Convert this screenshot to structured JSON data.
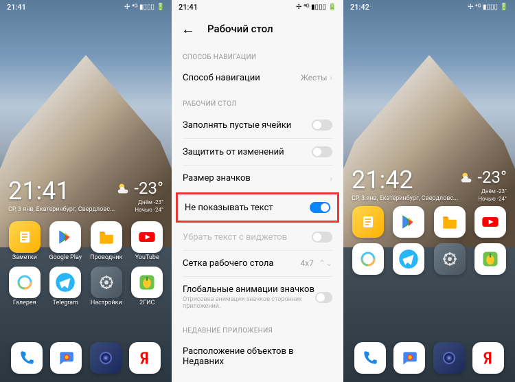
{
  "status": {
    "time1": "21:41",
    "time2": "21:41",
    "time3": "21:42",
    "icons": "✢ ⁴ᴳ ▮▯▯▯ 🔋"
  },
  "p1": {
    "clock": "21:41",
    "date": "СР, 3 янв, Екатеринбург, Свердловс...",
    "temp": "-23°",
    "wsub1": "Днём -23°",
    "wsub2": "Ночью -24°",
    "widgetTop": 260,
    "gridTop": 322,
    "apps": [
      {
        "key": "notes",
        "label": "Заметки"
      },
      {
        "key": "play",
        "label": "Google Play"
      },
      {
        "key": "files",
        "label": "Проводник"
      },
      {
        "key": "yt",
        "label": "YouTube"
      },
      {
        "key": "gallery",
        "label": "Галерея"
      },
      {
        "key": "tg",
        "label": "Telegram"
      },
      {
        "key": "settings",
        "label": "Настройки"
      },
      {
        "key": "2gis",
        "label": "2ГИС"
      }
    ]
  },
  "p3": {
    "clock": "21:42",
    "date": "СР, 3 янв, Екатеринбург, Свердловс...",
    "temp": "-23°",
    "wsub1": "Днём -23°",
    "wsub2": "Ночью -24°",
    "widgetTop": 244,
    "gridTop": 300,
    "apps": [
      {
        "key": "notes"
      },
      {
        "key": "play"
      },
      {
        "key": "files"
      },
      {
        "key": "yt"
      },
      {
        "key": "gallery"
      },
      {
        "key": "tg"
      },
      {
        "key": "settings"
      },
      {
        "key": "2gis"
      }
    ]
  },
  "dock": [
    {
      "key": "phone"
    },
    {
      "key": "msg"
    },
    {
      "key": "cam"
    },
    {
      "key": "ya"
    }
  ],
  "settings": {
    "title": "Рабочий стол",
    "sec1": "СПОСОБ НАВИГАЦИИ",
    "navMethod": "Способ навигации",
    "navVal": "Жесты",
    "sec2": "РАБОЧИЙ СТОЛ",
    "fillEmpty": "Заполнять пустые ячейки",
    "protect": "Защитить от изменений",
    "iconSize": "Размер значков",
    "hideText": "Не показывать текст",
    "removeWidget": "Убрать текст с виджетов",
    "grid": "Сетка рабочего стола",
    "gridVal": "4x7",
    "globalAnim": "Глобальные анимации значков",
    "globalAnimSub": "Отрисовка анимации значков сторонних приложений.",
    "sec3": "НЕДАВНИЕ ПРИЛОЖЕНИЯ",
    "recents": "Расположение объектов в Недавних"
  },
  "iconSvg": {
    "notes": "<svg viewBox='0 0 24 24' width='24' height='24'><rect x='5' y='4' width='14' height='16' rx='2' fill='#fff'/><path d='M8 8h8M8 12h8M8 16h5' stroke='#ffa000' stroke-width='1.5'/></svg>",
    "play": "<svg viewBox='0 0 24 24' width='26' height='26'><path d='M4 3l14 9L4 21z' fill='#34a853'/><path d='M4 3l8 9-8 9z' fill='#4285f4'/><path d='M12 12l6-3-6-6z' fill='#fbbc04' transform='translate(0 3)'/><path d='M12 12l6 3-6 6z' fill='#ea4335' transform='translate(0 -3)'/></svg>",
    "files": "<svg viewBox='0 0 24 24' width='26' height='26'><path d='M3 7h6l2 2h10v10a2 2 0 01-2 2H3z' fill='#ffb300'/><path d='M3 5h6l2 2H3z' fill='#ff8f00'/></svg>",
    "yt": "<svg viewBox='0 0 24 24' width='28' height='28'><rect x='2' y='6' width='20' height='12' rx='3' fill='#f00'/><path d='M10 9l6 3-6 3z' fill='#fff'/></svg>",
    "gallery": "<svg viewBox='0 0 24 24' width='24' height='24'><circle cx='12' cy='12' r='9' fill='none' stroke='#4fc3f7' stroke-width='3'/><circle cx='12' cy='12' r='9' fill='none' stroke='#ffb74d' stroke-width='3' stroke-dasharray='14 42'/><circle cx='12' cy='12' r='9' fill='none' stroke='#81c784' stroke-width='3' stroke-dasharray='14 42' stroke-dashoffset='-14'/></svg>",
    "tg": "<svg viewBox='0 0 24 24' width='30' height='30'><circle cx='12' cy='12' r='11' fill='#29b6f6'/><path d='M5 12l13-5-3 12-4-3-3 3z' fill='#fff'/></svg>",
    "settings": "<svg viewBox='0 0 24 24' width='24' height='24'><circle cx='12' cy='12' r='8' fill='none' stroke='#e0e0e0' stroke-width='2'/><circle cx='12' cy='12' r='3' fill='#e0e0e0'/><path d='M12 2v4M12 18v4M2 12h4M18 12h4M5 5l3 3M16 16l3 3M5 19l3-3M16 8l3-3' stroke='#e0e0e0' stroke-width='2'/></svg>",
    "2gis": "<svg viewBox='0 0 24 24' width='28' height='28'><rect x='3' y='3' width='18' height='18' rx='4' fill='#6cc24a'/><ellipse cx='12' cy='13' rx='5' ry='6' fill='#ffca28'/><rect x='11' y='5' width='2' height='5' fill='#388e3c'/></svg>",
    "phone": "<svg viewBox='0 0 24 24' width='26' height='26'><path d='M6 3c-1 0-2 1-2 2 0 8 7 15 15 15 1 0 2-1 2-2v-3l-4-1-2 2c-3-1-5-3-6-6l2-2-1-4z' fill='#1e88e5'/></svg>",
    "msg": "<svg viewBox='0 0 24 24' width='26' height='26'><path d='M4 4h16a2 2 0 012 2v9a2 2 0 01-2 2H9l-5 4V6a2 2 0 012-2z' fill='#4285f4'/><circle cx='13' cy='11' r='4' fill='#ea4335'/><circle cx='13' cy='11' r='2.5' fill='#fbbc04'/></svg>",
    "cam": "<svg viewBox='0 0 24 24' width='24' height='24'><circle cx='12' cy='12' r='8' fill='#1a2a5a' stroke='#5c6bc0' stroke-width='2'/><circle cx='12' cy='12' r='4' fill='#3949ab'/><circle cx='12' cy='12' r='2' fill='#7986cb'/></svg>",
    "ya": "<svg viewBox='0 0 24 24' width='26' height='26'><path d='M14 4h-3c-3 0-5 2-5 5 0 2 1 3.5 3 4.5L6 20h3l2.5-6H13v6h3V4z M13 6v6h-1.5c-1.5 0-2.5-1-2.5-3s1-3 2.5-3z' fill='#f00'/></svg>",
    "weather": "<svg viewBox='0 0 24 24' width='22' height='22'><circle cx='9' cy='9' r='4' fill='#ffd54f'/><path d='M6 14a4 4 0 118 0h2a3 3 0 110 6H6a3 3 0 110-6z' fill='#fff' opacity='.9'/></svg>"
  }
}
